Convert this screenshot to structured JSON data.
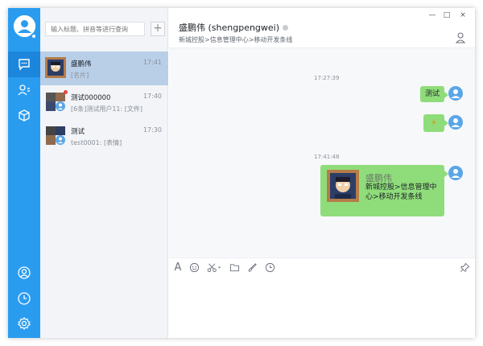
{
  "sidebar": {
    "items": [
      {
        "name": "messages",
        "icon": "chat-bubble-icon",
        "active": true
      },
      {
        "name": "contacts",
        "icon": "contacts-icon"
      },
      {
        "name": "apps",
        "icon": "cube-icon"
      }
    ],
    "bottom": [
      {
        "name": "profile",
        "icon": "user-circle-icon"
      },
      {
        "name": "history",
        "icon": "clock-icon"
      },
      {
        "name": "settings",
        "icon": "gear-icon"
      }
    ]
  },
  "search": {
    "placeholder": "输入标题、拼音等进行查询"
  },
  "conversations": [
    {
      "name": "盛鹏伟",
      "time": "17:41",
      "preview": "[名片]",
      "active": true
    },
    {
      "name": "测试000000",
      "time": "17:40",
      "preview": "[6条]测试用户11: [文件]",
      "unread": true
    },
    {
      "name": "测试",
      "time": "17:30",
      "preview": "test0001: [表情]"
    }
  ],
  "chat": {
    "contact_name": "盛鹏伟 (shengpengwei)",
    "contact_dept": "新城控股>信息管理中心>移动开发条线",
    "window_controls": [
      "—",
      "□",
      "×"
    ],
    "messages": [
      {
        "timestamp": "17:27:39"
      },
      {
        "type": "text",
        "text": "测试"
      },
      {
        "type": "emoji",
        "text": "⚡"
      },
      {
        "timestamp": "17:41:48"
      },
      {
        "type": "card",
        "name": "盛鹏伟",
        "desc": "新城控股>信息管理中心>移动开发条线"
      }
    ]
  },
  "toolbar": {
    "items": [
      "font-icon",
      "emoji-icon",
      "scissors-icon",
      "folder-icon",
      "paint-icon",
      "clock-icon",
      "pin-icon"
    ],
    "font_label": "A"
  },
  "colors": {
    "accent": "#2a9cf0",
    "bubble": "#8fdd7a",
    "active_conv": "#b9cfe8"
  }
}
